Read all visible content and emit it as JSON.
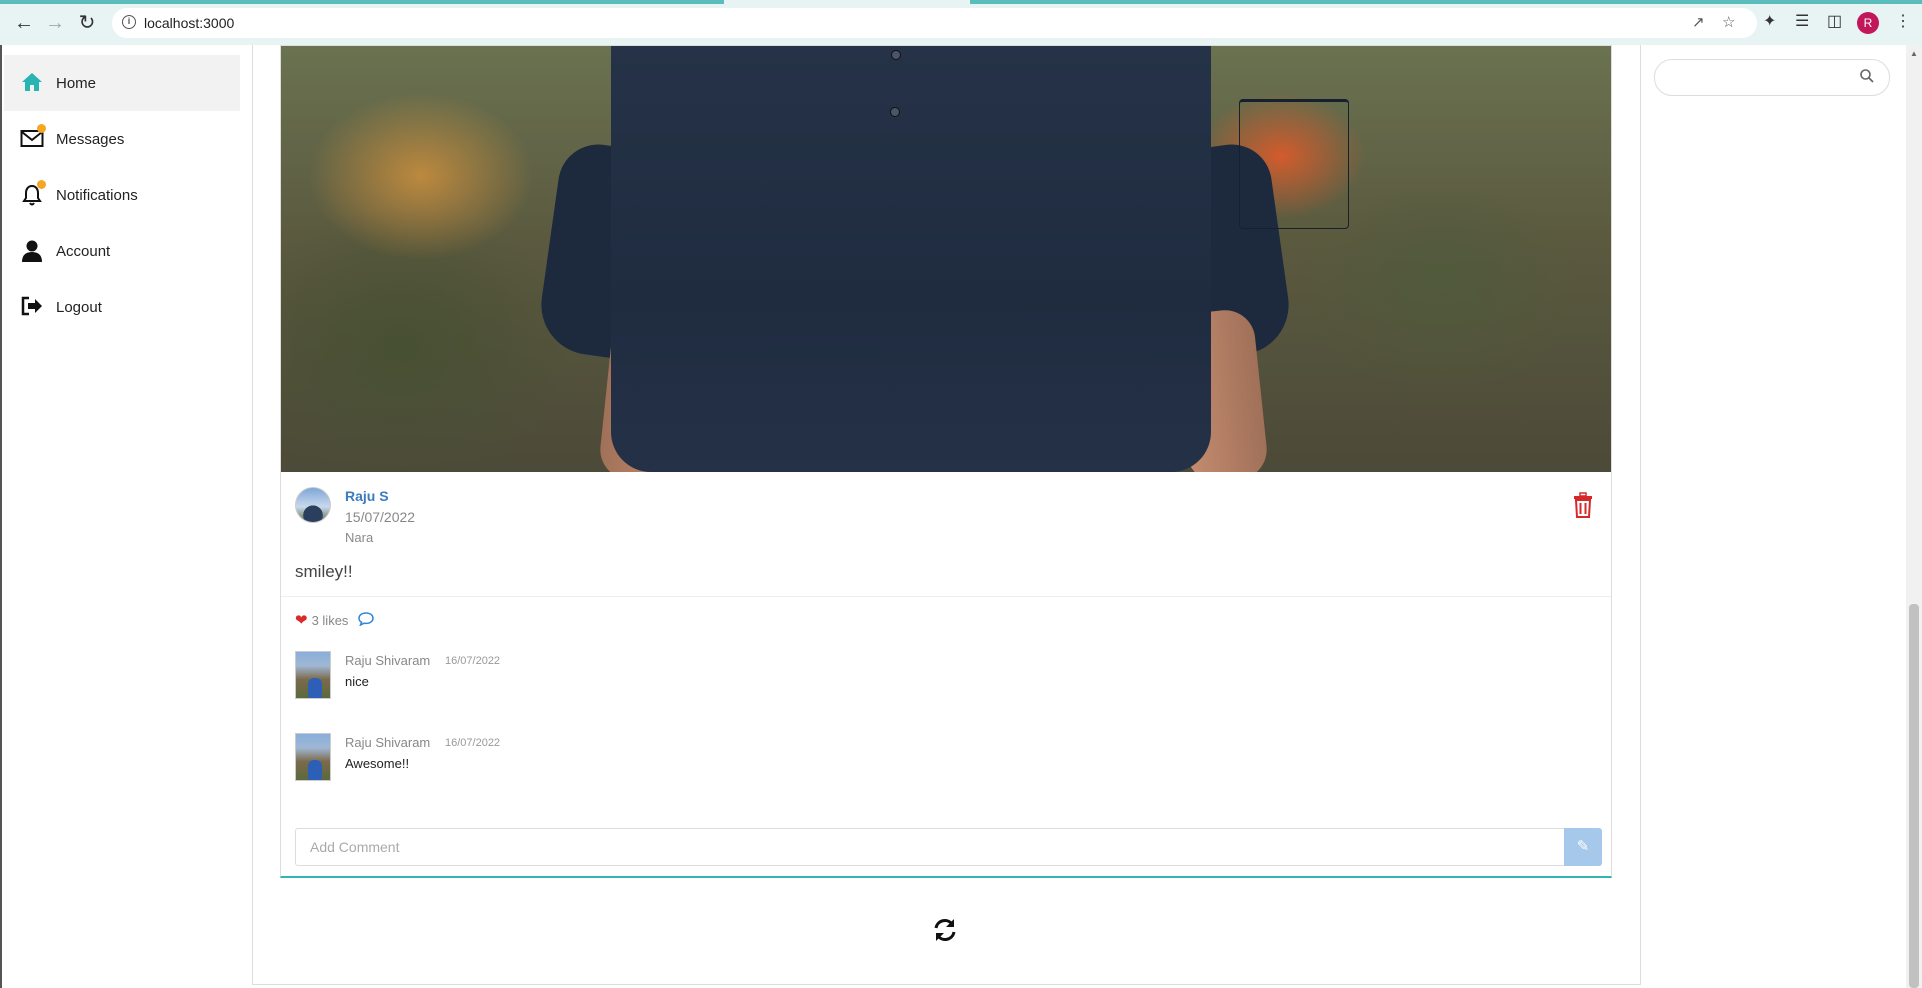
{
  "browser": {
    "url": "localhost:3000",
    "profile_initial": "R"
  },
  "sidebar": {
    "items": [
      {
        "label": "Home",
        "icon": "home-icon",
        "active": true
      },
      {
        "label": "Messages",
        "icon": "envelope-icon",
        "badge": true
      },
      {
        "label": "Notifications",
        "icon": "bell-icon",
        "badge": true
      },
      {
        "label": "Account",
        "icon": "user-icon"
      },
      {
        "label": "Logout",
        "icon": "sign-out-icon"
      }
    ]
  },
  "post": {
    "author": "Raju S",
    "date": "15/07/2022",
    "location": "Nara",
    "text": "smiley!!",
    "likes_label": "3 likes",
    "comments": [
      {
        "author": "Raju Shivaram",
        "date": "16/07/2022",
        "text": "nice"
      },
      {
        "author": "Raju Shivaram",
        "date": "16/07/2022",
        "text": "Awesome!!"
      }
    ],
    "comment_placeholder": "Add Comment"
  },
  "search": {
    "placeholder": ""
  },
  "colors": {
    "accent_teal": "#33b5b5",
    "link_blue": "#3b7bbf",
    "like_red": "#d92b2b",
    "delete_red": "#d62828",
    "badge_orange": "#f5a623",
    "submit_blue": "#a6c8ea"
  }
}
